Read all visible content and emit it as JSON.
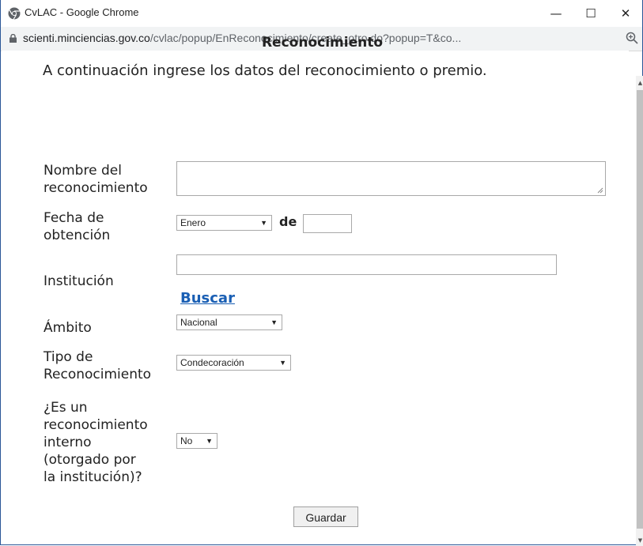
{
  "window": {
    "title": "CvLAC - Google Chrome",
    "minimize": "—",
    "maximize": "☐",
    "close": "✕"
  },
  "address_bar": {
    "url_host": "scienti.minciencias.gov.co",
    "url_path": "/cvlac/popup/EnReconocimiento/create_otro.do?popup=T&co..."
  },
  "form": {
    "heading": "Reconocimiento",
    "intro": "A continuación ingrese los datos del reconocimiento o premio.",
    "nombre_label_1": "Nombre del",
    "nombre_label_2": "reconocimiento",
    "nombre_value": "",
    "fecha_label_1": "Fecha de",
    "fecha_label_2": "obtención",
    "fecha_month": "Enero",
    "fecha_de": "de",
    "fecha_year": "",
    "institucion_label": "Institución",
    "institucion_value": "",
    "buscar_link": "Buscar",
    "ambito_label": "Ámbito",
    "ambito_value": "Nacional",
    "tipo_label_1": "Tipo de",
    "tipo_label_2": "Reconocimiento",
    "tipo_value": "Condecoración",
    "interno_label_1": "¿Es un",
    "interno_label_2": "reconocimiento",
    "interno_label_3": "interno",
    "interno_label_4": "(otorgado por",
    "interno_label_5": "la institución)?",
    "interno_value": "No",
    "guardar_button": "Guardar"
  },
  "colors": {
    "window_border": "#2b5797",
    "link": "#1a5fb4",
    "addr_bg": "#f1f3f4"
  }
}
